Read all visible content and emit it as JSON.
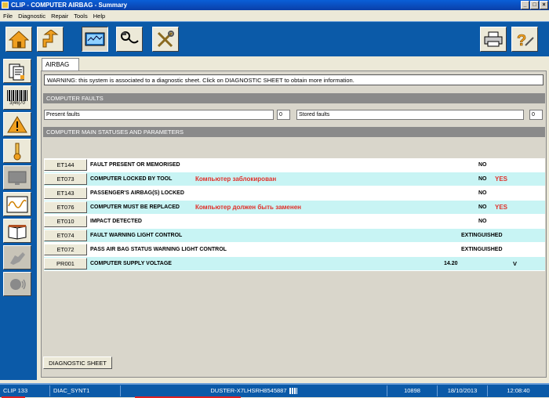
{
  "window": {
    "title": "CLIP - COMPUTER AIRBAG - Summary",
    "controls": [
      "_",
      "□",
      "×"
    ]
  },
  "menu": [
    "File",
    "Diagnostic",
    "Repair",
    "Tools",
    "Help"
  ],
  "toolbar": {
    "buttons": [
      "home-icon",
      "back-icon",
      "measure-icon",
      "probe-icon",
      "tools-icon"
    ],
    "right_buttons": [
      "printer-icon",
      "help-icon"
    ]
  },
  "sidebar": {
    "items": [
      "document-icon",
      "barcode-icon",
      "warning-icon",
      "thermometer-icon",
      "screen-icon",
      "oscilloscope-icon",
      "book-icon",
      "hand-icon",
      "voice-icon"
    ],
    "barcode_text": "3|46|70"
  },
  "tab": {
    "label": "AIRBAG"
  },
  "warning": "WARNING: this system is associated to a diagnostic sheet. Click on DIAGNOSTIC SHEET to obtain more information.",
  "faults": {
    "header": "COMPUTER FAULTS",
    "present_label": "Present faults",
    "present_count": "0",
    "stored_label": "Stored faults",
    "stored_count": "0"
  },
  "statuses": {
    "header": "COMPUTER MAIN STATUSES AND PARAMETERS",
    "rows": [
      {
        "code": "ET144",
        "desc": "FAULT PRESENT OR MEMORISED",
        "annotation": "",
        "value": "NO",
        "yes": "",
        "unit": ""
      },
      {
        "code": "ET073",
        "desc": "COMPUTER LOCKED BY TOOL",
        "annotation": "Компьютер заблокирован",
        "value": "NO",
        "yes": "YES",
        "unit": ""
      },
      {
        "code": "ET143",
        "desc": "PASSENGER'S AIRBAG(S) LOCKED",
        "annotation": "",
        "value": "NO",
        "yes": "",
        "unit": ""
      },
      {
        "code": "ET076",
        "desc": "COMPUTER MUST BE REPLACED",
        "annotation": "Компьютер должен быть заменен",
        "value": "NO",
        "yes": "YES",
        "unit": ""
      },
      {
        "code": "ET010",
        "desc": "IMPACT DETECTED",
        "annotation": "",
        "value": "NO",
        "yes": "",
        "unit": ""
      },
      {
        "code": "ET074",
        "desc": "FAULT WARNING LIGHT CONTROL",
        "annotation": "",
        "value": "EXTINGUISHED",
        "yes": "",
        "unit": ""
      },
      {
        "code": "ET072",
        "desc": "PASS AIR BAG STATUS WARNING LIGHT CONTROL",
        "annotation": "",
        "value": "EXTINGUISHED",
        "yes": "",
        "unit": ""
      },
      {
        "code": "PR001",
        "desc": "COMPUTER SUPPLY VOLTAGE",
        "annotation": "",
        "value": "14.20",
        "yes": "",
        "unit": "V"
      }
    ]
  },
  "diagnostic_sheet_button": "DIAGNOSTIC SHEET",
  "statusbar": {
    "clip": "CLIP 133",
    "diag": "DIAC_SYNT1",
    "vin": "DUSTER-X7LHSRH8545887",
    "code": "10898",
    "date": "18/10/2013",
    "time": "12:08:40"
  },
  "colors": {
    "chrome_blue": "#0b5aa8",
    "row_cyan": "#c8f4f4",
    "annotation_red": "#e0302a"
  }
}
